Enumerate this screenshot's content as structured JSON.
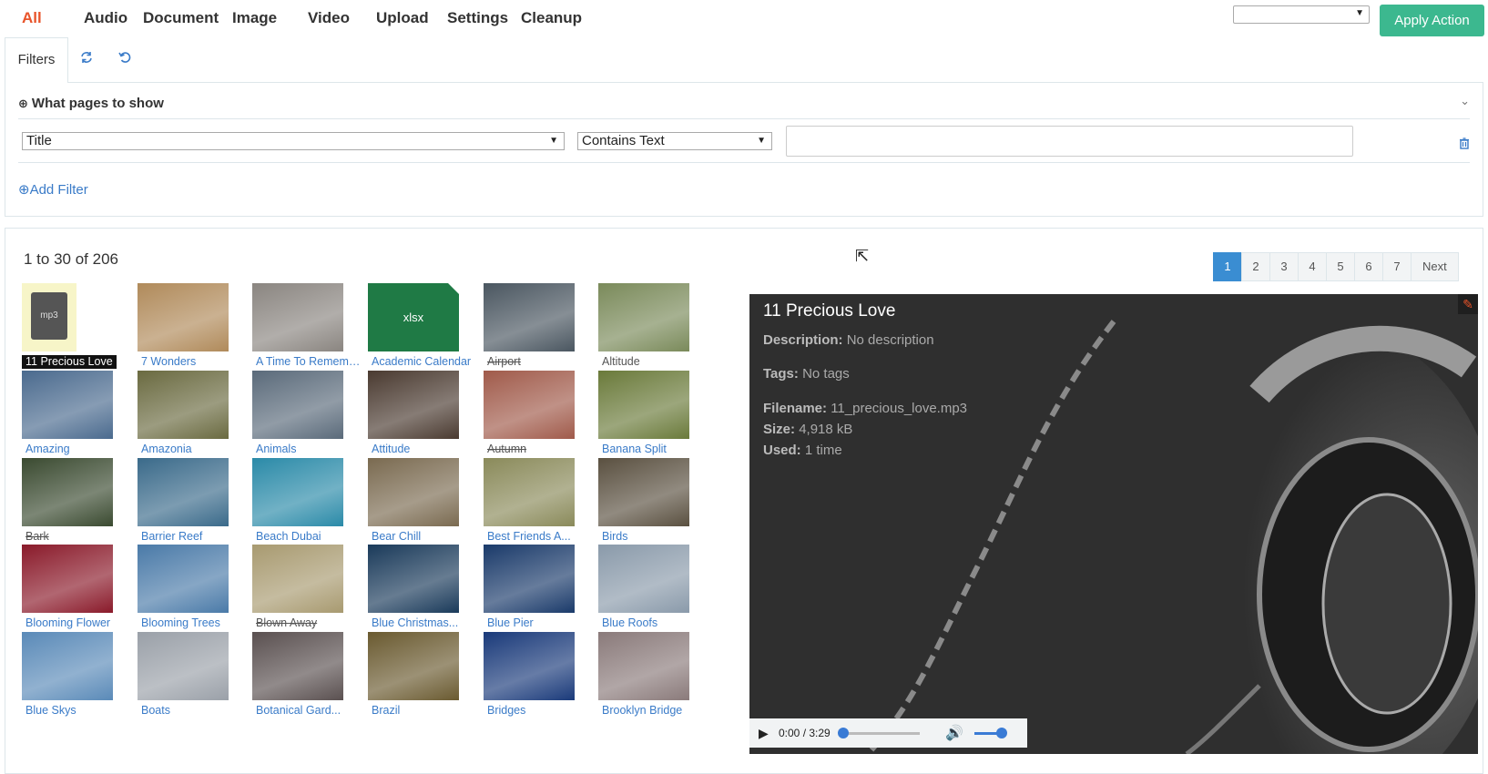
{
  "nav": {
    "items": [
      {
        "label": "All",
        "active": true
      },
      {
        "label": "Audio"
      },
      {
        "label": "Document"
      },
      {
        "label": "Image"
      },
      {
        "label": "Video"
      },
      {
        "label": "Upload"
      },
      {
        "label": "Settings"
      },
      {
        "label": "Cleanup"
      }
    ],
    "action_select_value": "",
    "apply_label": "Apply Action"
  },
  "tabs": {
    "filters_label": "Filters",
    "icons": [
      "refresh-icon",
      "undo-icon"
    ]
  },
  "filter_panel": {
    "header": "What pages to show",
    "field_select": "Title",
    "operator_select": "Contains Text",
    "value_input": "",
    "add_filter_label": "Add Filter"
  },
  "results": {
    "count_text": "1 to 30 of 206",
    "pages": [
      "1",
      "2",
      "3",
      "4",
      "5",
      "6",
      "7"
    ],
    "current_page": "1",
    "next_label": "Next",
    "items": [
      {
        "name": "11 Precious Love",
        "type": "mp3",
        "selected": true
      },
      {
        "name": "7 Wonders",
        "color": "#b08a5a"
      },
      {
        "name": "A Time To Remember",
        "color": "#8a8580"
      },
      {
        "name": "Academic Calendar",
        "type": "xlsx"
      },
      {
        "name": "Airport",
        "color": "#4a5660",
        "strike": true
      },
      {
        "name": "Altitude",
        "color": "#7a8a5a",
        "dark": true
      },
      {
        "name": "Amazing",
        "color": "#4a6a8e"
      },
      {
        "name": "Amazonia",
        "color": "#6a6a40"
      },
      {
        "name": "Animals",
        "color": "#5a6a7a"
      },
      {
        "name": "Attitude",
        "color": "#4a3a30"
      },
      {
        "name": "Autumn",
        "color": "#a05a4a",
        "strike": true
      },
      {
        "name": "Banana Split",
        "color": "#6a7a3a"
      },
      {
        "name": "Bark",
        "color": "#3a4a30",
        "strike": true
      },
      {
        "name": "Barrier Reef",
        "color": "#3a6a8a"
      },
      {
        "name": "Beach Dubai",
        "color": "#2a8aa8"
      },
      {
        "name": "Bear Chill",
        "color": "#7a6a50"
      },
      {
        "name": "Best Friends A...",
        "color": "#8a8a5a"
      },
      {
        "name": "Birds",
        "color": "#5a5040"
      },
      {
        "name": "Blooming Flower",
        "color": "#8a1a2a"
      },
      {
        "name": "Blooming Trees",
        "color": "#4a7aa8"
      },
      {
        "name": "Blown Away",
        "color": "#a89a70",
        "strike": true
      },
      {
        "name": "Blue Christmas...",
        "color": "#1a3a5a"
      },
      {
        "name": "Blue Pier",
        "color": "#1a3a6a"
      },
      {
        "name": "Blue Roofs",
        "color": "#8a9aaa"
      },
      {
        "name": "Blue Skys",
        "color": "#5a8ab8"
      },
      {
        "name": "Boats",
        "color": "#9aa0a8"
      },
      {
        "name": "Botanical Gard...",
        "color": "#5a5050"
      },
      {
        "name": "Brazil",
        "color": "#6a5a30"
      },
      {
        "name": "Bridges",
        "color": "#1a3a7a"
      },
      {
        "name": "Brooklyn Bridge",
        "color": "#8a7a7a"
      }
    ]
  },
  "preview": {
    "title": "11 Precious Love",
    "description_label": "Description:",
    "description_value": "No description",
    "tags_label": "Tags:",
    "tags_value": "No tags",
    "filename_label": "Filename:",
    "filename_value": "11_precious_love.mp3",
    "size_label": "Size:",
    "size_value": "4,918 kB",
    "used_label": "Used:",
    "used_value": "1 time",
    "audio_time": "0:00 / 3:29",
    "audio_progress": 0,
    "audio_volume": 1
  },
  "colors": {
    "accent": "#e8542a",
    "apply_button": "#3cb88f",
    "link": "#3a7bc8",
    "pager_active": "#3a8dd2",
    "preview_bg": "#2f2f2f"
  }
}
